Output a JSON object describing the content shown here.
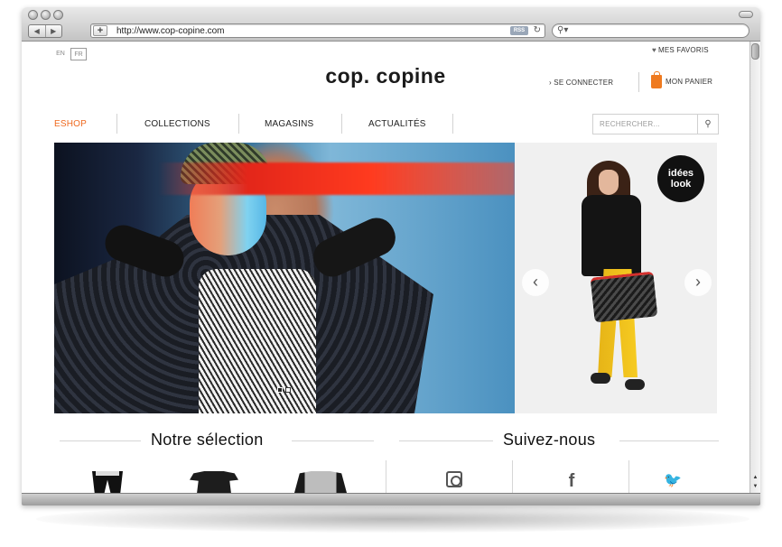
{
  "browser": {
    "url": "http://www.cop-copine.com",
    "rss_label": "RSS",
    "back_icon": "back-arrow-icon",
    "forward_icon": "forward-arrow-icon",
    "reload_icon": "reload-icon"
  },
  "header": {
    "lang_en": "EN",
    "lang_fr": "FR",
    "logo": "cop. copine",
    "favoris": "MES FAVORIS",
    "connect": "SE CONNECTER",
    "panier": "MON PANIER"
  },
  "nav": {
    "items": [
      {
        "label": "ESHOP",
        "active": true
      },
      {
        "label": "COLLECTIONS"
      },
      {
        "label": "MAGASINS"
      },
      {
        "label": "ACTUALITÉS"
      }
    ],
    "search_placeholder": "RECHERCHER..."
  },
  "look": {
    "badge_line1": "idées",
    "badge_line2": "look"
  },
  "sections": {
    "selection": "Notre sélection",
    "follow": "Suivez-nous"
  },
  "social": {
    "facebook_glyph": "f"
  },
  "colors": {
    "accent": "#ef6a20",
    "bag": "#ef7a1f"
  }
}
